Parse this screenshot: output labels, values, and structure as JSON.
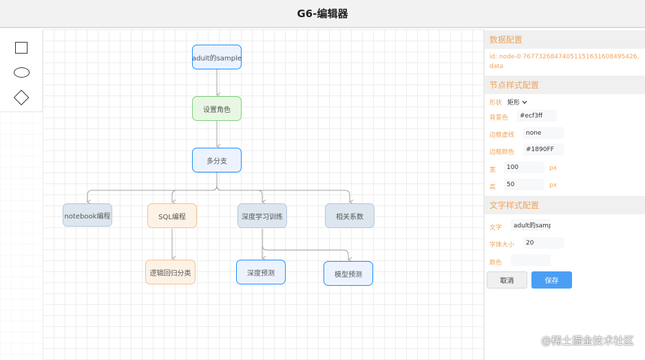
{
  "header": {
    "title": "G6-编辑器"
  },
  "palette": {
    "shapes": [
      {
        "icon": "rect-icon"
      },
      {
        "icon": "ellipse-icon"
      },
      {
        "icon": "diamond-icon"
      }
    ]
  },
  "canvas": {
    "nodes": {
      "root": "adult的sample",
      "role": "设置角色",
      "branch": "多分支",
      "notebook": "notebook编程",
      "sql": "SQL编程",
      "deep": "深度学习训练",
      "corr": "相关系数",
      "logreg": "逻辑回归分类",
      "deep_pred": "深度预测",
      "model_pred": "模型预测"
    },
    "colors": {
      "blue_fill": "#ecf3ff",
      "blue_border": "#1890ff",
      "green_fill": "#e8f7e4",
      "green_border": "#7ed07a",
      "orange_fill": "#fdf2e6",
      "orange_border": "#f5c28e",
      "gray_fill": "#dde6ef",
      "gray_border": "#b4c6d8",
      "edge": "#a0a0a0"
    }
  },
  "panel": {
    "data_section": "数据配置",
    "data_info": "id: node-0 76773268474051151631608495426, data",
    "node_style_section": "节点样式配置",
    "shape_label": "形状",
    "shape_value": "矩形",
    "bg_label": "背景色",
    "bg_value": "#ecf3ff",
    "border_dash_label": "边框虚线",
    "border_dash_value": "none",
    "border_color_label": "边框颜色",
    "border_color_value": "#1890FF",
    "width_label": "宽",
    "width_value": "100",
    "height_label": "高",
    "height_value": "50",
    "unit_px": "px",
    "text_style_section": "文字样式配置",
    "text_label": "文字",
    "text_value": "adult的samp",
    "font_size_label": "字体大小",
    "font_size_value": "20",
    "color_label": "颜色",
    "color_value": "",
    "cancel_label": "取消",
    "save_label": "保存"
  },
  "watermark": "@稀土掘金技术社区"
}
